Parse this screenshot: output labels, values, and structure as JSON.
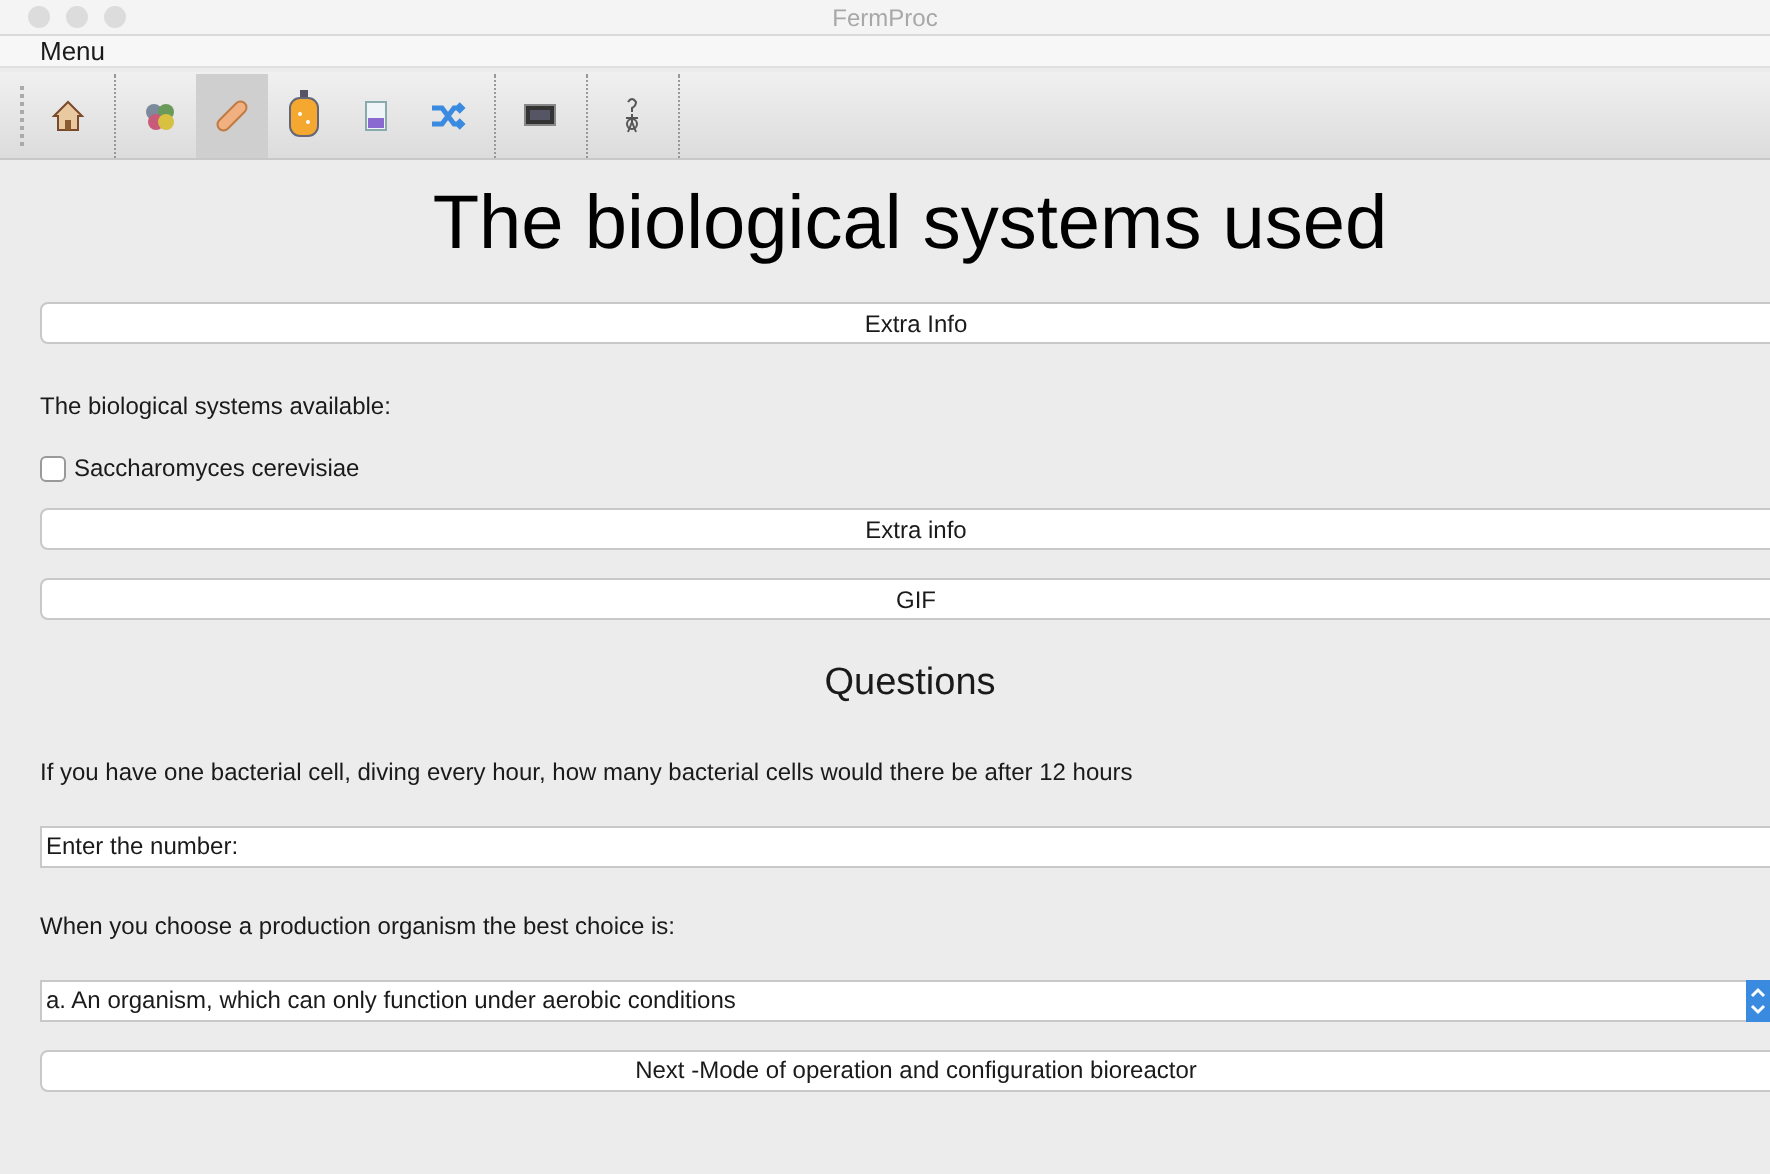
{
  "window": {
    "title": "FermProc"
  },
  "menu": [
    "Menu"
  ],
  "toolbar": [
    {
      "kind": "home",
      "selected": false,
      "sep_after": true
    },
    {
      "kind": "cells",
      "selected": false,
      "sep_after": false
    },
    {
      "kind": "bandage",
      "selected": true,
      "sep_after": false
    },
    {
      "kind": "reactor",
      "selected": false,
      "sep_after": false
    },
    {
      "kind": "beaker",
      "selected": false,
      "sep_after": false
    },
    {
      "kind": "shuffle",
      "selected": false,
      "sep_after": true
    },
    {
      "kind": "monitor",
      "selected": false,
      "sep_after": true
    },
    {
      "kind": "figure",
      "selected": false,
      "sep_after": true
    }
  ],
  "heading": "The biological systems used",
  "extra_info_button": "Extra Info",
  "systems_label": "The biological systems available:",
  "systems": [
    {
      "label": "Saccharomyces cerevisiae",
      "checked": false
    }
  ],
  "buttons": [
    "Extra info",
    "GIF"
  ],
  "questions_heading": "Questions",
  "question_1": "If you have one bacterial cell, diving every hour, how many bacterial cells would there be after 12 hours",
  "answer_1": {
    "value": "Enter the number:"
  },
  "question_2": "When you choose a production organism the best choice is:",
  "answer_2": {
    "value": "a. An organism, which can only function under aerobic conditions"
  },
  "next_button": "Next -Mode of operation and configuration bioreactor"
}
